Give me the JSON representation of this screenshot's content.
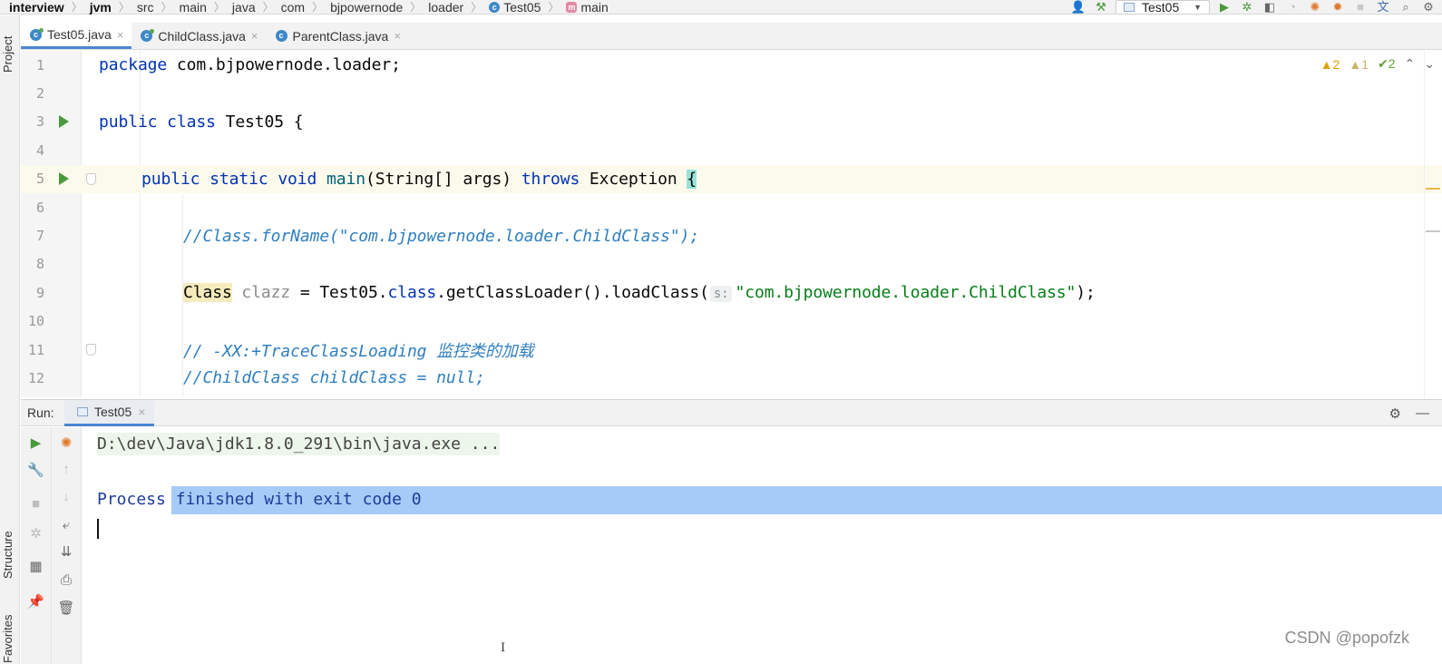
{
  "breadcrumbs": [
    "interview",
    "jvm",
    "src",
    "main",
    "java",
    "com",
    "bjpowernode",
    "loader",
    "Test05",
    "main"
  ],
  "toolbar": {
    "run_config": "Test05",
    "icons": [
      "user-icon",
      "build-hammer-icon",
      "run-icon",
      "debug-icon",
      "coverage-icon",
      "profile-icon",
      "stop-icon",
      "translate-icon",
      "search-icon",
      "settings-icon"
    ]
  },
  "left_strip": {
    "project": "Project",
    "structure": "Structure",
    "favorites": "Favorites"
  },
  "tabs": [
    {
      "label": "Test05.java",
      "active": true
    },
    {
      "label": "ChildClass.java",
      "active": false
    },
    {
      "label": "ParentClass.java",
      "active": false
    }
  ],
  "inspections": {
    "warnings": "2",
    "weak_warnings": "1",
    "typos": "2"
  },
  "code": {
    "line_numbers": [
      "1",
      "2",
      "3",
      "4",
      "5",
      "6",
      "7",
      "8",
      "9",
      "10",
      "11",
      "12"
    ],
    "l1_kw": "package",
    "l1_rest": " com.bjpowernode.loader;",
    "l3_kw": "public class",
    "l3_rest": " Test05 {",
    "l5_kw1": "public static void",
    "l5_fn": "main",
    "l5_mid": "(String[] args) ",
    "l5_kw2": "throws",
    "l5_rest": " Exception ",
    "l5_brace": "{",
    "l7_comment": "//Class.forName(\"com.bjpowernode.loader.ChildClass\");",
    "l9_type": "Class",
    "l9_var": " clazz",
    "l9_mid": " = Test05.",
    "l9_kw": "class",
    "l9_call": ".getClassLoader().loadClass(",
    "l9_hint": "s:",
    "l9_str": "\"com.bjpowernode.loader.ChildClass\"",
    "l9_end": ");",
    "l11_comment": "// -XX:+TraceClassLoading 监控类的加载",
    "l12_comment": "//ChildClass childClass = null;"
  },
  "run_panel": {
    "label": "Run:",
    "tab": "Test05",
    "cmd": "D:\\dev\\Java\\jdk1.8.0_291\\bin\\java.exe ...",
    "result": "Process finished with exit code 0"
  },
  "watermark": "CSDN @popofzk",
  "colors": {
    "keyword": "#0033b3",
    "comment": "#2f7fc0",
    "string": "#067d17",
    "selection": "#a6cbf7",
    "current_line": "#fcfaed",
    "tab_underline": "#4d85d1"
  }
}
